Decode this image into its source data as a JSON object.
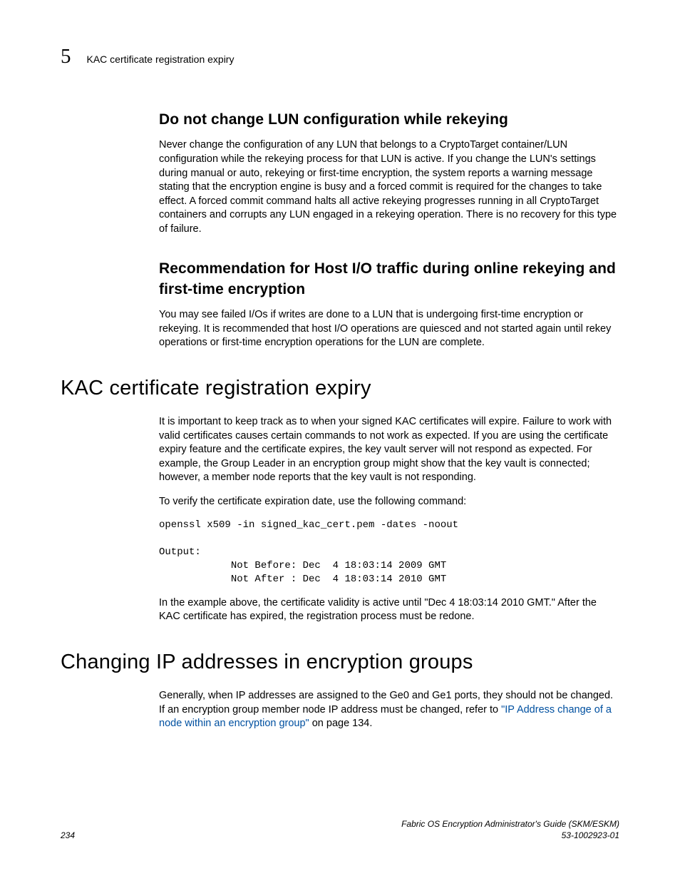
{
  "header": {
    "chapter_number": "5",
    "running_title": "KAC certificate registration expiry"
  },
  "section1": {
    "heading": "Do not change LUN configuration while rekeying",
    "para": "Never change the configuration of any LUN that belongs to a CryptoTarget container/LUN configuration while the rekeying process for that LUN is active. If you change the LUN's settings during manual or auto, rekeying or first-time encryption, the system reports a warning message stating that the encryption engine is busy and a forced commit is required for the changes to take effect. A forced commit command halts all active rekeying progresses running in all CryptoTarget containers and corrupts any LUN engaged in a rekeying operation. There is no recovery for this type of failure."
  },
  "section2": {
    "heading": "Recommendation for Host I/O traffic during online rekeying and first-time encryption",
    "para": "You may see failed I/Os if writes are done to a LUN that is undergoing first-time encryption or rekeying. It is recommended that host I/O operations are quiesced and not started again until rekey operations or first-time encryption operations for the LUN are complete."
  },
  "section3": {
    "heading": "KAC certificate registration expiry",
    "para1": "It is important to keep track as to when your signed KAC certificates will expire. Failure to work with valid certificates causes certain commands to not work as expected. If you are using the certificate expiry feature and the certificate expires, the key vault server will not respond as expected. For example, the Group Leader in an encryption group might show that the key vault is connected; however, a member node reports that the key vault is not responding.",
    "para2": "To verify the certificate expiration date, use the following command:",
    "code": "openssl x509 -in signed_kac_cert.pem -dates -noout\n\nOutput:\n            Not Before: Dec  4 18:03:14 2009 GMT\n            Not After : Dec  4 18:03:14 2010 GMT",
    "para3": "In the example above, the certificate validity is active until \"Dec 4 18:03:14 2010 GMT.\" After the KAC certificate has expired, the registration process must be redone."
  },
  "section4": {
    "heading": "Changing IP addresses in encryption groups",
    "para_pre": "Generally, when IP addresses are assigned to the Ge0 and Ge1 ports, they should not be changed. If an encryption group member node IP address must be changed, refer to ",
    "link_text": "\"IP Address change of a node within an encryption group\"",
    "para_post": " on page 134."
  },
  "footer": {
    "page_number": "234",
    "doc_title": "Fabric OS Encryption Administrator's Guide (SKM/ESKM)",
    "doc_id": "53-1002923-01"
  }
}
